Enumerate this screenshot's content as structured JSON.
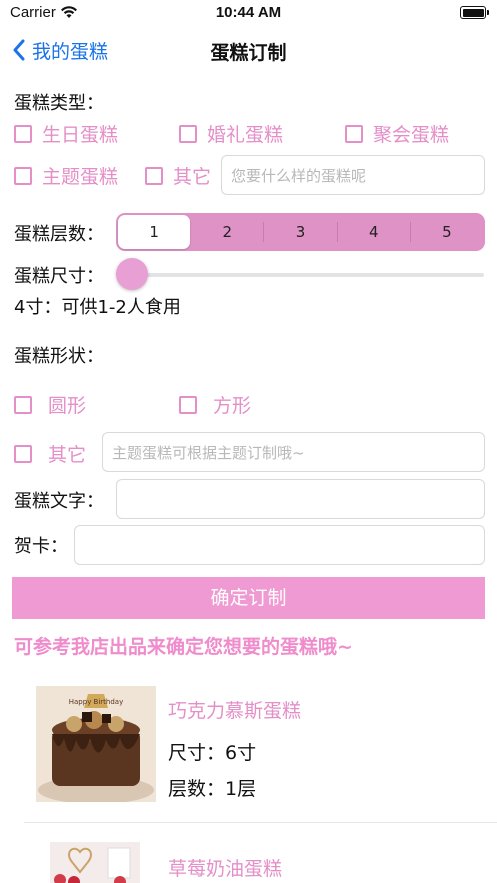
{
  "status_bar": {
    "carrier": "Carrier",
    "time": "10:44 AM"
  },
  "nav": {
    "back_label": "我的蛋糕",
    "title": "蛋糕订制"
  },
  "cake_type": {
    "label": "蛋糕类型：",
    "options": [
      "生日蛋糕",
      "婚礼蛋糕",
      "聚会蛋糕",
      "主题蛋糕",
      "其它"
    ],
    "other_placeholder": "您要什么样的蛋糕呢"
  },
  "layers": {
    "label": "蛋糕层数：",
    "options": [
      "1",
      "2",
      "3",
      "4",
      "5"
    ],
    "selected": "1"
  },
  "size": {
    "label": "蛋糕尺寸：",
    "value_text": "4寸：可供1-2人食用",
    "slider_fraction": 0
  },
  "shape": {
    "label": "蛋糕形状：",
    "options": [
      "圆形",
      "方形",
      "其它"
    ],
    "other_placeholder": "主题蛋糕可根据主题订制哦~"
  },
  "cake_text": {
    "label": "蛋糕文字：",
    "value": ""
  },
  "card": {
    "label": "贺卡：",
    "value": ""
  },
  "confirm_label": "确定订制",
  "reference_title": "可参考我店出品来确定您想要的蛋糕哦~",
  "products": [
    {
      "name": "巧克力慕斯蛋糕",
      "size": "尺寸：6寸",
      "layers": "层数：1层",
      "image_text": "Happy Birthday"
    },
    {
      "name": "草莓奶油蛋糕"
    }
  ],
  "colors": {
    "accent_pink": "#e58fc9",
    "button_pink": "#ef9ad2",
    "nav_blue": "#1a73e8"
  }
}
